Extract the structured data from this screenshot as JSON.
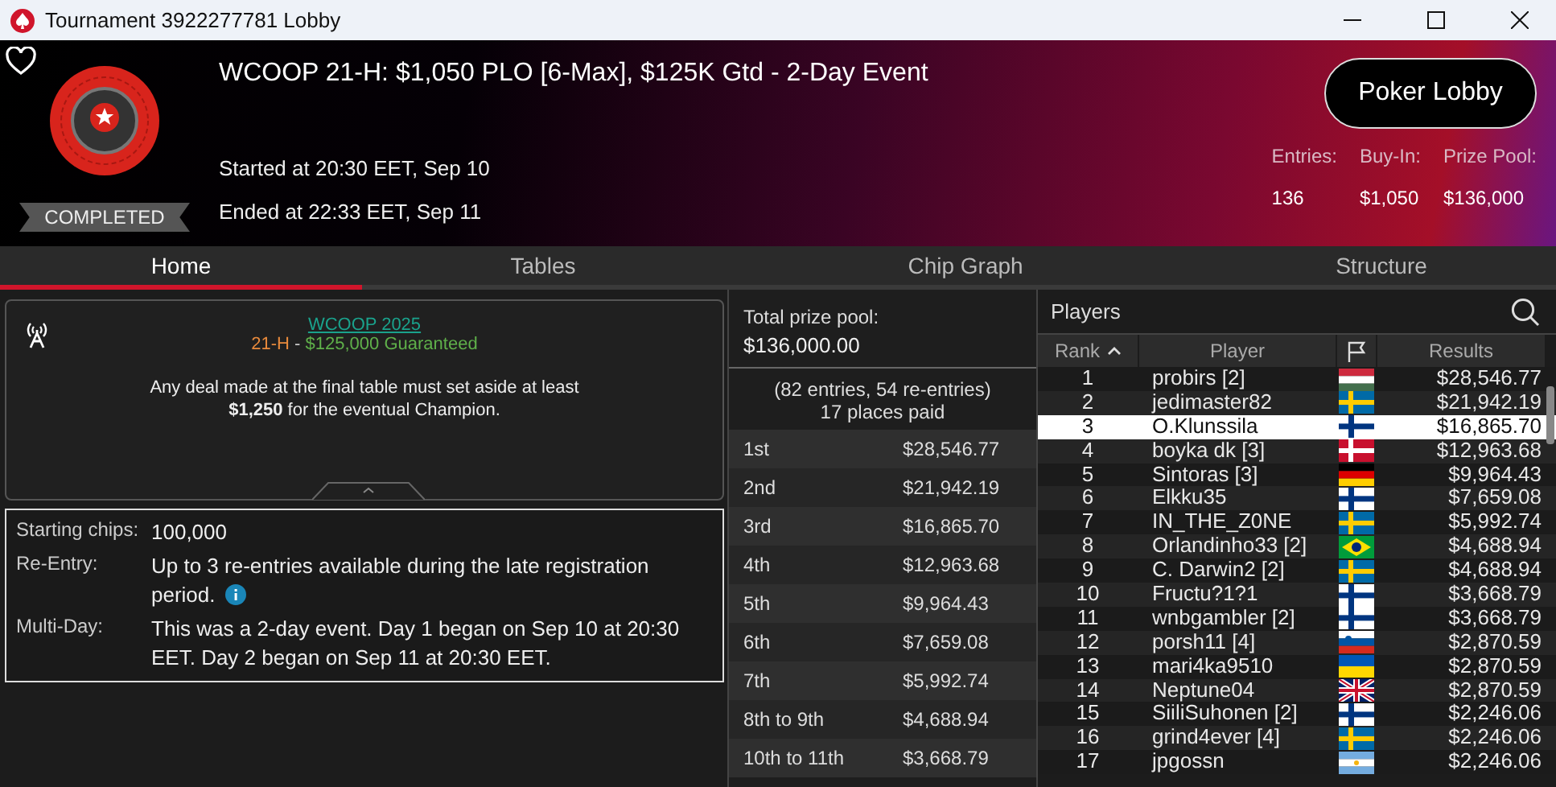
{
  "window": {
    "title": "Tournament 3922277781 Lobby"
  },
  "header": {
    "title": "WCOOP 21-H: $1,050 PLO [6-Max], $125K Gtd - 2-Day Event",
    "status": "COMPLETED",
    "started": "Started at 20:30 EET, Sep 10",
    "ended": "Ended at 22:33 EET, Sep 11",
    "button": "Poker Lobby",
    "stats": [
      {
        "label": "Entries:",
        "value": "136"
      },
      {
        "label": "Buy-In:",
        "value": "$1,050"
      },
      {
        "label": "Prize Pool:",
        "value": "$136,000"
      }
    ]
  },
  "tabs": [
    {
      "label": "Home",
      "selected": true
    },
    {
      "label": "Tables",
      "selected": false
    },
    {
      "label": "Chip Graph",
      "selected": false
    },
    {
      "label": "Structure",
      "selected": false
    }
  ],
  "notice": {
    "link": "WCOOP 2025",
    "event_code": "21-H",
    "separator": " - ",
    "guarantee": "$125,000 Guaranteed",
    "message": "Any deal made at the final table must set aside at least **$1,250** for the eventual Champion."
  },
  "info": [
    {
      "label": "Starting chips:",
      "value": "100,000",
      "info_icon": false
    },
    {
      "label": "Re-Entry:",
      "value": "Up to 3 re-entries available during the late registration period.",
      "info_icon": true
    },
    {
      "label": "Multi-Day:",
      "value": "This was a 2-day event. Day 1 began on Sep 10 at 20:30 EET. Day 2 began on Sep 11 at 20:30 EET.",
      "info_icon": false
    }
  ],
  "prizes": {
    "total_label": "Total prize pool:",
    "total": "$136,000.00",
    "entries": "(82 entries, 54 re-entries)",
    "places": "17 places paid",
    "rows": [
      {
        "place": "1st",
        "amount": "$28,546.77"
      },
      {
        "place": "2nd",
        "amount": "$21,942.19"
      },
      {
        "place": "3rd",
        "amount": "$16,865.70"
      },
      {
        "place": "4th",
        "amount": "$12,963.68"
      },
      {
        "place": "5th",
        "amount": "$9,964.43"
      },
      {
        "place": "6th",
        "amount": "$7,659.08"
      },
      {
        "place": "7th",
        "amount": "$5,992.74"
      },
      {
        "place": "8th to 9th",
        "amount": "$4,688.94"
      },
      {
        "place": "10th to 11th",
        "amount": "$3,668.79"
      }
    ]
  },
  "players": {
    "title": "Players",
    "columns": [
      "Rank",
      "Player",
      "Results"
    ],
    "rows": [
      {
        "rank": "1",
        "name": "probirs [2]",
        "flag": {
          "kind": "hu"
        },
        "result": "$28,546.77",
        "selected": false
      },
      {
        "rank": "2",
        "name": "jedimaster82",
        "flag": {
          "kind": "se"
        },
        "result": "$21,942.19",
        "selected": false
      },
      {
        "rank": "3",
        "name": "O.Klunssila",
        "flag": {
          "kind": "fi"
        },
        "result": "$16,865.70",
        "selected": true
      },
      {
        "rank": "4",
        "name": "boyka dk [3]",
        "flag": {
          "kind": "dk"
        },
        "result": "$12,963.68",
        "selected": false
      },
      {
        "rank": "5",
        "name": "Sintoras [3]",
        "flag": {
          "kind": "de"
        },
        "result": "$9,964.43",
        "selected": false
      },
      {
        "rank": "6",
        "name": "Elkku35",
        "flag": {
          "kind": "fi"
        },
        "result": "$7,659.08",
        "selected": false
      },
      {
        "rank": "7",
        "name": "IN_THE_Z0NE",
        "flag": {
          "kind": "se"
        },
        "result": "$5,992.74",
        "selected": false
      },
      {
        "rank": "8",
        "name": "Orlandinho33 [2]",
        "flag": {
          "kind": "br"
        },
        "result": "$4,688.94",
        "selected": false
      },
      {
        "rank": "9",
        "name": "C. Darwin2 [2]",
        "flag": {
          "kind": "se"
        },
        "result": "$4,688.94",
        "selected": false
      },
      {
        "rank": "10",
        "name": "Fructu?1?1",
        "flag": {
          "kind": "fi"
        },
        "result": "$3,668.79",
        "selected": false
      },
      {
        "rank": "11",
        "name": "wnbgambler [2]",
        "flag": {
          "kind": "fi"
        },
        "result": "$3,668.79",
        "selected": false
      },
      {
        "rank": "12",
        "name": "porsh11 [4]",
        "flag": {
          "kind": "si"
        },
        "result": "$2,870.59",
        "selected": false
      },
      {
        "rank": "13",
        "name": "mari4ka9510",
        "flag": {
          "kind": "ua"
        },
        "result": "$2,870.59",
        "selected": false
      },
      {
        "rank": "14",
        "name": "Neptune04",
        "flag": {
          "kind": "gb"
        },
        "result": "$2,870.59",
        "selected": false
      },
      {
        "rank": "15",
        "name": "SiiliSuhonen [2]",
        "flag": {
          "kind": "fi"
        },
        "result": "$2,246.06",
        "selected": false
      },
      {
        "rank": "16",
        "name": "grind4ever [4]",
        "flag": {
          "kind": "se"
        },
        "result": "$2,246.06",
        "selected": false
      },
      {
        "rank": "17",
        "name": "jpgossn",
        "flag": {
          "kind": "ar"
        },
        "result": "$2,246.06",
        "selected": false
      }
    ]
  }
}
